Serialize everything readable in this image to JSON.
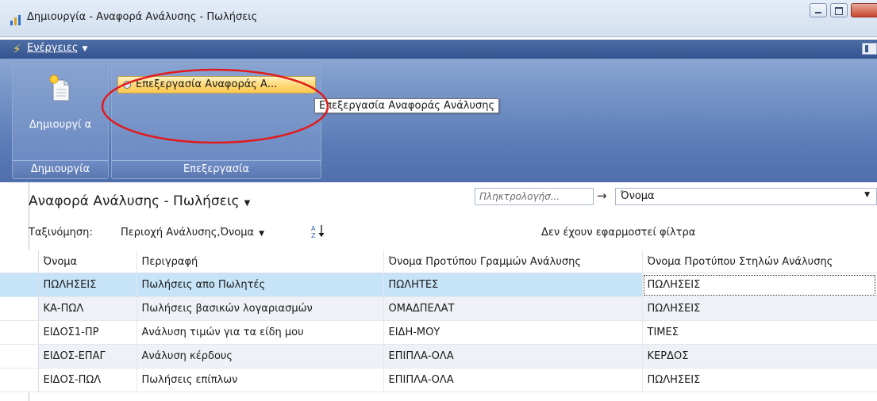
{
  "window": {
    "title": "Δημιουργία - Αναφορά Ανάλυσης - Πωλήσεις"
  },
  "ribbon": {
    "actions_menu_label": "Ενέργειες",
    "groups": [
      {
        "label": "Δημιουργία",
        "button_label": "Δημιουργί α"
      },
      {
        "label": "Επεξεργασία",
        "button_label": "Επεξεργασία Αναφοράς Α..."
      }
    ],
    "tooltip": "Επεξεργασία Αναφοράς Ανάλυσης",
    "highlight_color": "#e11b1b"
  },
  "list": {
    "title": "Αναφορά Ανάλυσης - Πωλήσεις",
    "search_placeholder": "Πληκτρολογήσ...",
    "search_field": "Όνομα",
    "sort_label": "Ταξινόμηση:",
    "sort_field": "Περιοχή Ανάλυσης,Όνομα",
    "filter_status": "Δεν έχουν εφαρμοστεί φίλτρα",
    "columns": [
      "Όνομα",
      "Περιγραφή",
      "Όνομα Προτύπου Γραμμών Ανάλυσης",
      "Όνομα Προτύπου Στηλών Ανάλυσης"
    ],
    "rows": [
      [
        "ΠΩΛΗΣΕΙΣ",
        "Πωλήσεις απο Πωλητές",
        "ΠΩΛΗΤΕΣ",
        "ΠΩΛΗΣΕΙΣ"
      ],
      [
        "ΚΑ-ΠΩΛ",
        "Πωλήσεις βασικών λογαριασμών",
        "ΟΜΑΔΠΕΛΑΤ",
        "ΠΩΛΗΣΕΙΣ"
      ],
      [
        "ΕΙΔΟΣ1-ΠΡ",
        "Ανάλυση τιμών για τα είδη μου",
        "ΕΙΔΗ-ΜΟΥ",
        "ΤΙΜΕΣ"
      ],
      [
        "ΕΙΔΟΣ-ΕΠΑΓ",
        "Ανάλυση κέρδους",
        "ΕΠΙΠΛΑ-ΟΛΑ",
        "ΚΕΡΔΟΣ"
      ],
      [
        "ΕΙΔΟΣ-ΠΩΛ",
        "Πωλήσεις επίπλων",
        "ΕΠΙΠΛΑ-ΟΛΑ",
        "ΠΩΛΗΣΕΙΣ"
      ]
    ]
  }
}
